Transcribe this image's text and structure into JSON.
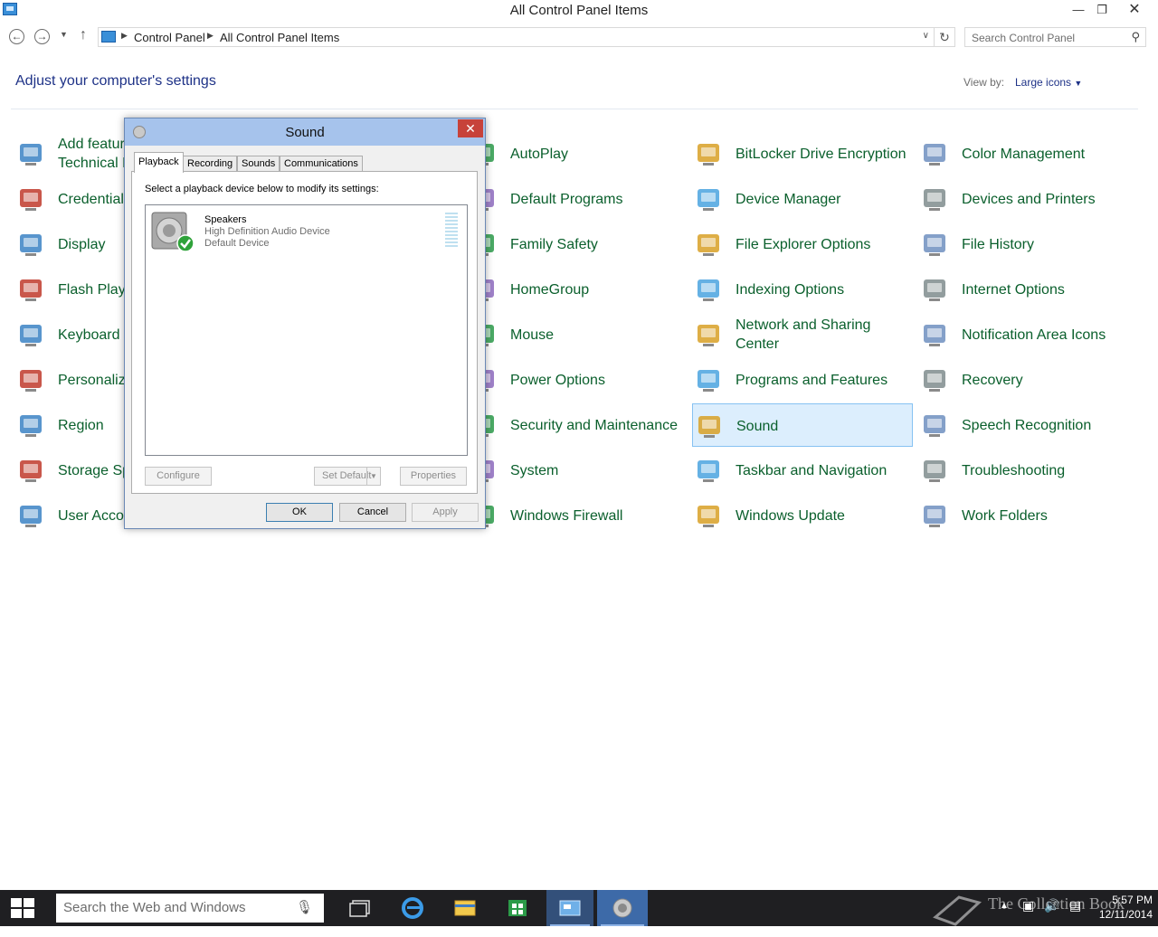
{
  "window": {
    "title": "All Control Panel Items"
  },
  "nav": {
    "breadcrumb": [
      "Control Panel",
      "All Control Panel Items"
    ],
    "search_placeholder": "Search Control Panel"
  },
  "header": {
    "title": "Adjust your computer's settings",
    "view_by_label": "View by:",
    "view_by_value": "Large icons"
  },
  "items": [
    {
      "label": "Add features to Windows Technical Preview",
      "icon": "add-features-icon",
      "visible": "Add feature\nTechnical P"
    },
    {
      "label": "AutoPlay",
      "icon": "autoplay-icon"
    },
    {
      "label": "BitLocker Drive Encryption",
      "icon": "bitlocker-icon"
    },
    {
      "label": "Color Management",
      "icon": "color-management-icon"
    },
    {
      "label": "Credential Manager",
      "icon": "credential-manager-icon",
      "visible": "Credential"
    },
    {
      "label": "Default Programs",
      "icon": "default-programs-icon"
    },
    {
      "label": "Device Manager",
      "icon": "device-manager-icon"
    },
    {
      "label": "Devices and Printers",
      "icon": "printer-icon"
    },
    {
      "label": "Display",
      "icon": "display-icon"
    },
    {
      "label": "Family Safety",
      "icon": "family-safety-icon"
    },
    {
      "label": "File Explorer Options",
      "icon": "folder-options-icon"
    },
    {
      "label": "File History",
      "icon": "file-history-icon"
    },
    {
      "label": "Flash Player",
      "icon": "flash-icon",
      "visible": "Flash Playe"
    },
    {
      "label": "HomeGroup",
      "icon": "homegroup-icon"
    },
    {
      "label": "Indexing Options",
      "icon": "indexing-icon"
    },
    {
      "label": "Internet Options",
      "icon": "internet-options-icon"
    },
    {
      "label": "Keyboard",
      "icon": "keyboard-icon"
    },
    {
      "label": "Mouse",
      "icon": "mouse-icon"
    },
    {
      "label": "Network and Sharing Center",
      "icon": "network-icon"
    },
    {
      "label": "Notification Area Icons",
      "icon": "notification-area-icon"
    },
    {
      "label": "Personalization",
      "icon": "personalization-icon",
      "visible": "Personaliza"
    },
    {
      "label": "Power Options",
      "icon": "power-icon"
    },
    {
      "label": "Programs and Features",
      "icon": "programs-icon"
    },
    {
      "label": "Recovery",
      "icon": "recovery-icon"
    },
    {
      "label": "Region",
      "icon": "region-icon"
    },
    {
      "label": "Security and Maintenance",
      "icon": "security-flag-icon"
    },
    {
      "label": "Sound",
      "icon": "speaker-icon",
      "selected": true
    },
    {
      "label": "Speech Recognition",
      "icon": "microphone-icon"
    },
    {
      "label": "Storage Spaces",
      "icon": "storage-icon",
      "visible": "Storage Sp"
    },
    {
      "label": "System",
      "icon": "system-icon"
    },
    {
      "label": "Taskbar and Navigation",
      "icon": "taskbar-icon"
    },
    {
      "label": "Troubleshooting",
      "icon": "troubleshooting-icon"
    },
    {
      "label": "User Accounts",
      "icon": "user-accounts-icon",
      "visible": "User Accou"
    },
    {
      "label": "Windows Firewall",
      "icon": "firewall-icon"
    },
    {
      "label": "Windows Update",
      "icon": "windows-update-icon"
    },
    {
      "label": "Work Folders",
      "icon": "work-folders-icon"
    }
  ],
  "dialog": {
    "title": "Sound",
    "close": "✕",
    "tabs": [
      "Playback",
      "Recording",
      "Sounds",
      "Communications"
    ],
    "active_tab": "Playback",
    "instruction": "Select a playback device below to modify its settings:",
    "device": {
      "name": "Speakers",
      "description": "High Definition Audio Device",
      "status": "Default Device"
    },
    "buttons": {
      "configure": "Configure",
      "set_default": "Set Default",
      "properties": "Properties",
      "ok": "OK",
      "cancel": "Cancel",
      "apply": "Apply"
    }
  },
  "taskbar": {
    "search_placeholder": "Search the Web and Windows",
    "watermark": "The Collection Book",
    "time": "5:57 PM",
    "date": "12/11/2014"
  },
  "colors": {
    "link_green": "#0a5f2c",
    "heading_blue": "#1e3287",
    "dialog_title": "#a6c3ec",
    "close_red": "#c7423a",
    "selection": "#dceefd",
    "taskbar": "#1f1f22"
  }
}
